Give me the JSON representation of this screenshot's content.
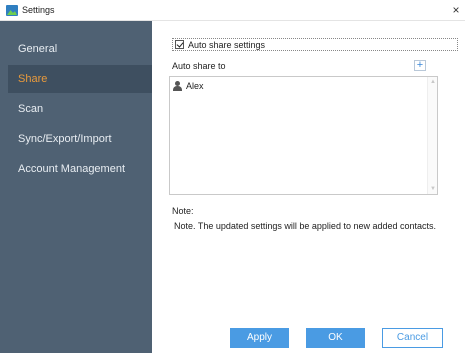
{
  "window": {
    "title": "Settings",
    "close_glyph": "×"
  },
  "sidebar": {
    "items": [
      {
        "label": "General",
        "active": false
      },
      {
        "label": "Share",
        "active": true
      },
      {
        "label": "Scan",
        "active": false
      },
      {
        "label": "Sync/Export/Import",
        "active": false
      },
      {
        "label": "Account Management",
        "active": false
      }
    ]
  },
  "share": {
    "auto_share_label": "Auto share settings",
    "auto_share_checked": true,
    "auto_share_to_label": "Auto share to",
    "add_glyph": "+",
    "contacts": [
      {
        "name": "Alex",
        "icon": "user-icon"
      }
    ],
    "note_title": "Note:",
    "note_text": "Note. The updated settings will be applied to new added contacts."
  },
  "buttons": {
    "apply": "Apply",
    "ok": "OK",
    "cancel": "Cancel"
  },
  "colors": {
    "sidebar_bg": "#4f6173",
    "sidebar_active_bg": "#3e4f60",
    "sidebar_active_text": "#e89a3c",
    "primary_button": "#4a9be3"
  }
}
